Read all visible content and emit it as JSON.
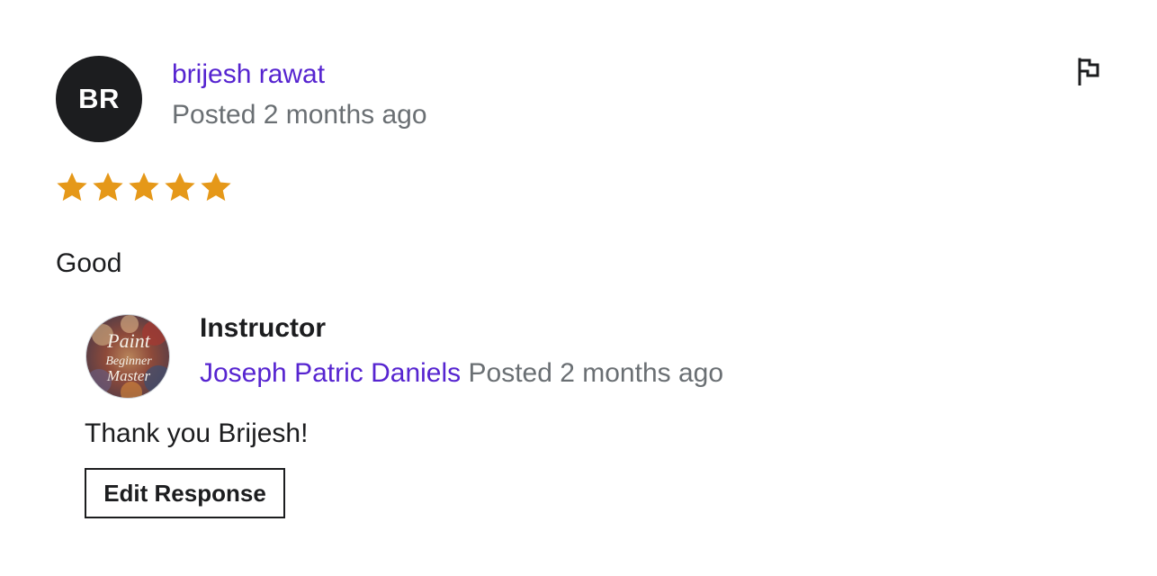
{
  "review": {
    "reviewer": {
      "initials": "BR",
      "name": "brijesh rawat",
      "posted": "Posted 2 months ago"
    },
    "rating": {
      "value": 5,
      "max": 5
    },
    "text": "Good",
    "flag_icon": "flag-icon"
  },
  "response": {
    "avatar_text": [
      "Paint",
      "Beginner",
      "Master"
    ],
    "role": "Instructor",
    "name": "Joseph Patric Daniels",
    "posted": "Posted 2 months ago",
    "text": "Thank you Brijesh!",
    "edit_label": "Edit Response"
  },
  "colors": {
    "link": "#5624d0",
    "muted": "#6a6f73",
    "star": "#e59819",
    "text": "#1c1d1f"
  }
}
